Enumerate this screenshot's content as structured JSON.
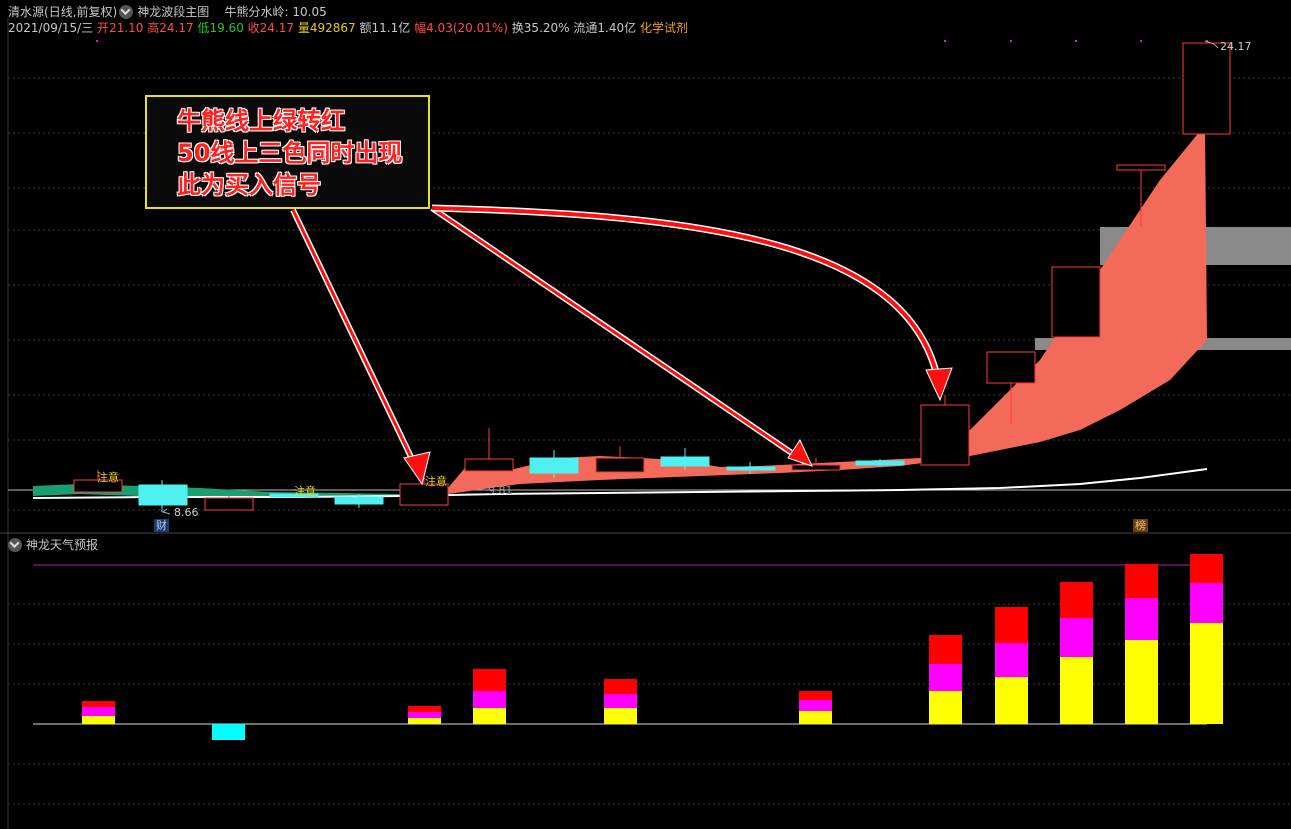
{
  "header": {
    "stock_name": "清水源",
    "period": "(日线,前复权)",
    "indicator1": "神龙波段主图",
    "indicator1_param_label": "牛熊分水岭:",
    "indicator1_param_value": "10.05"
  },
  "quote": {
    "date": "2021/09/15/三",
    "open_label": "开",
    "open": "21.10",
    "high_label": "高",
    "high": "24.17",
    "low_label": "低",
    "low": "19.60",
    "close_label": "收",
    "close": "24.17",
    "volume_label": "量",
    "volume": "492867",
    "amount_label": "额",
    "amount": "11.1亿",
    "change_label": "幅",
    "change": "4.03(20.01%)",
    "turnover_label": "换",
    "turnover": "35.20%",
    "float_label": "流通",
    "float_value": "1.40亿",
    "sector": "化学试剂"
  },
  "annotation": {
    "line1": "牛熊线上绿转红",
    "line2": "50线上三色同时出现",
    "line3": "此为买入信号"
  },
  "price_labels": {
    "low_mark": "8.66",
    "high_mark": "24.17",
    "mid_mark": "9.81"
  },
  "signals": {
    "notice": "注意"
  },
  "badges": {
    "cai": "财",
    "bang": "榜"
  },
  "subchart": {
    "title": "神龙天气预报"
  },
  "colors": {
    "up": "#ff3b3b",
    "down": "#4ef0f0",
    "band_up": "#f46a5a",
    "band_down": "#1aa070",
    "bar_yellow": "#ffff00",
    "bar_magenta": "#ff00ff",
    "bar_red": "#ff0000",
    "bar_cyan": "#00ffff",
    "annotation_border": "#e6e020",
    "arrow": "#ff1010"
  }
}
